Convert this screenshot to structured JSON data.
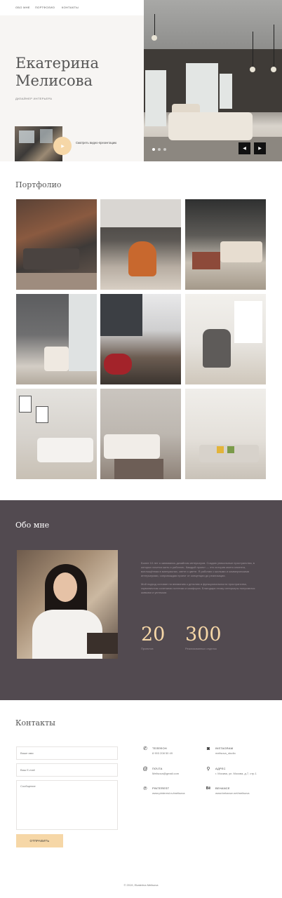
{
  "nav": {
    "items": [
      "ОБО МНЕ",
      "ПОРТФОЛИО",
      "КОНТАКТЫ"
    ]
  },
  "hero": {
    "name_line1": "Екатерина",
    "name_line2": "Мелисова",
    "subtitle": "ДИЗАЙНЕР ИНТЕРЬЕРА",
    "video_label": "Смотреть видео-презентацию",
    "slides": 3,
    "active_slide": 1,
    "prev_icon": "arrow-left-icon",
    "next_icon": "arrow-right-icon"
  },
  "portfolio": {
    "title": "Портфолио",
    "tiles": 9
  },
  "about": {
    "title": "Обо мне",
    "paragraph1": "Более 10 лет я занимаюсь дизайном интерьеров. Создаю уникальные пространства, в которых хочется жить и работать. Каждый проект — это история моего клиента, воплощённая в материалах, свете и цвете. Я работаю с жилыми и коммерческими интерьерами, сопровождая проект от концепции до реализации.",
    "paragraph2": "Мой подход основан на вниманию к деталям и функциональности пространства, гармоничном сочетании эстетики и комфорта. Благодаря этому интерьеры получаются живыми и уютными.",
    "stats": [
      {
        "value": "20",
        "label": "Проектов"
      },
      {
        "value": "300",
        "label": "Реализованных отделок"
      }
    ]
  },
  "contacts": {
    "title": "Контакты",
    "form": {
      "name_placeholder": "Ваше имя",
      "email_placeholder": "Ваш E-mail",
      "message_placeholder": "Сообщение",
      "submit_label": "ОТПРАВИТЬ"
    },
    "items": [
      {
        "icon": "phone-icon",
        "label": "ТЕЛЕФОН",
        "value": "8 903 208 50 49"
      },
      {
        "icon": "instagram-icon",
        "label": "INSTAGRAM",
        "value": "melisova_studio"
      },
      {
        "icon": "email-icon",
        "label": "ПОЧТА",
        "value": "Melisova@gmail.com"
      },
      {
        "icon": "location-icon",
        "label": "АДРЕС",
        "value": "г. Москва, ул. Москва, д.7, стр.1"
      },
      {
        "icon": "pinterest-icon",
        "label": "PINTEREST",
        "value": "www.pinterest.ru/melisova"
      },
      {
        "icon": "behance-icon",
        "label": "BEHANCE",
        "value": "www.behance.net/melisova"
      }
    ]
  },
  "footer": {
    "text": "© 2019, Ekaterina Melisova"
  },
  "colors": {
    "accent": "#f6d7a7",
    "about_bg": "#524a50"
  }
}
